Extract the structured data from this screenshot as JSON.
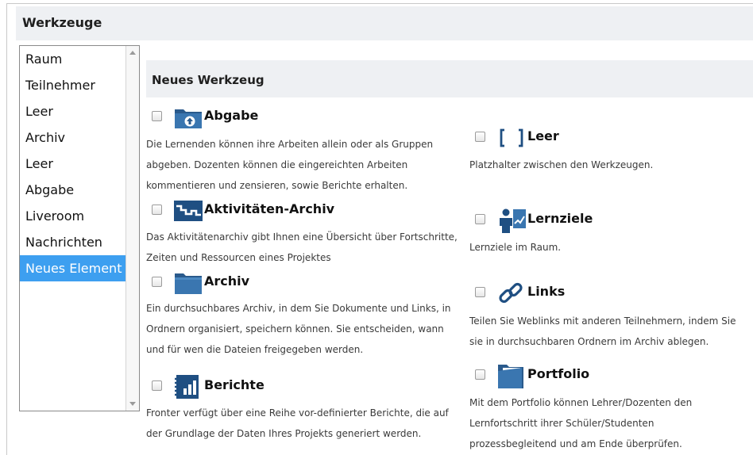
{
  "header": {
    "title": "Werkzeuge"
  },
  "sidebar": {
    "items": [
      {
        "label": "Raum"
      },
      {
        "label": "Teilnehmer"
      },
      {
        "label": "Leer"
      },
      {
        "label": "Archiv"
      },
      {
        "label": "Leer"
      },
      {
        "label": "Abgabe"
      },
      {
        "label": "Liveroom"
      },
      {
        "label": "Nachrichten"
      },
      {
        "label": "Neues Element",
        "selected": true
      }
    ]
  },
  "panel": {
    "title": "Neues Werkzeug"
  },
  "tools_left": [
    {
      "name": "Abgabe",
      "icon": "upload-folder-icon",
      "desc": [
        "Die Lernenden können ihre Arbeiten allein oder als Gruppen",
        "abgeben. Dozenten können die eingereichten Arbeiten",
        "kommentieren und zensieren, sowie Berichte erhalten."
      ]
    },
    {
      "name": "Aktivitäten-Archiv",
      "icon": "activity-chart-icon",
      "desc": [
        "Das Aktivitätenarchiv gibt Ihnen eine Übersicht über Fortschritte,",
        "Zeiten und Ressourcen eines Projektes"
      ]
    },
    {
      "name": "Archiv",
      "icon": "folder-icon",
      "desc": [
        "Ein durchsuchbares Archiv, in dem Sie Dokumente und Links, in",
        "Ordnern organisiert, speichern können. Sie entscheiden, wann",
        "und für wen die Dateien freigegeben werden."
      ]
    },
    {
      "name": "Berichte",
      "icon": "report-icon",
      "desc": [
        "Fronter verfügt über eine Reihe vor-definierter Berichte, die auf",
        "der Grundlage der Daten Ihres Projekts generiert werden."
      ]
    }
  ],
  "tools_right": [
    {
      "name": "Leer",
      "icon": "brackets-icon",
      "desc": [
        "Platzhalter zwischen den Werkzeugen."
      ]
    },
    {
      "name": "Lernziele",
      "icon": "goal-person-icon",
      "desc": [
        "Lernziele im Raum."
      ]
    },
    {
      "name": "Links",
      "icon": "chain-link-icon",
      "desc": [
        "Teilen Sie Weblinks mit anderen Teilnehmern, indem Sie",
        "sie in durchsuchbaren Ordnern im Archiv ablegen."
      ]
    },
    {
      "name": "Portfolio",
      "icon": "portfolio-folder-icon",
      "desc": [
        "Mit dem Portfolio können Lehrer/Dozenten den",
        "Lernfortschritt ihrer Schüler/Studenten",
        "prozessbegleitend und am Ende überprüfen."
      ]
    }
  ],
  "colors": {
    "accent": "#3d9ff0",
    "header_bg": "#eef0f3",
    "icon_blue": "#1f4f82"
  }
}
